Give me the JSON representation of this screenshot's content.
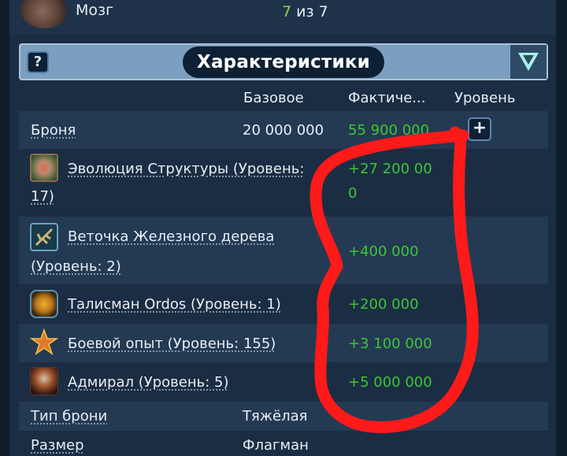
{
  "top_item": {
    "label": "Мозг",
    "count_current": "7",
    "count_rest": " из 7"
  },
  "header": {
    "help_symbol": "?",
    "title": "Характеристики"
  },
  "columns": {
    "base": "Базовое",
    "actual": "Фактиче...",
    "level": "Уровень"
  },
  "armor": {
    "label": "Броня",
    "base": "20 000 000",
    "actual": "55 900 000",
    "plus_symbol": "+"
  },
  "bonuses": [
    {
      "label_line1": "Эволюция Структуры (Уровень:",
      "label_line2": "17)",
      "value_line1": "+27 200 00",
      "value_line2": "0",
      "icon": "structure-evolution-icon"
    },
    {
      "label_line1": "Веточка Железного дерева",
      "label_line2": "(Уровень: 2)",
      "value": "+400 000",
      "icon": "iron-tree-branch-icon"
    },
    {
      "label": "Талисман Ordos (Уровень: 1)",
      "value": "+200 000",
      "icon": "ordos-talisman-icon"
    },
    {
      "label": "Боевой опыт (Уровень: 155)",
      "value": "+3 100 000",
      "icon": "combat-experience-icon"
    },
    {
      "label": "Адмирал (Уровень: 5)",
      "value": "+5 000 000",
      "icon": "admiral-icon"
    }
  ],
  "armor_type": {
    "label": "Тип брони",
    "value": "Тяжёлая"
  },
  "size": {
    "label": "Размер",
    "value": "Флагман"
  },
  "colors": {
    "positive": "#3ec43a",
    "annotation": "#ff1a1a",
    "background": "#1b2d42"
  }
}
